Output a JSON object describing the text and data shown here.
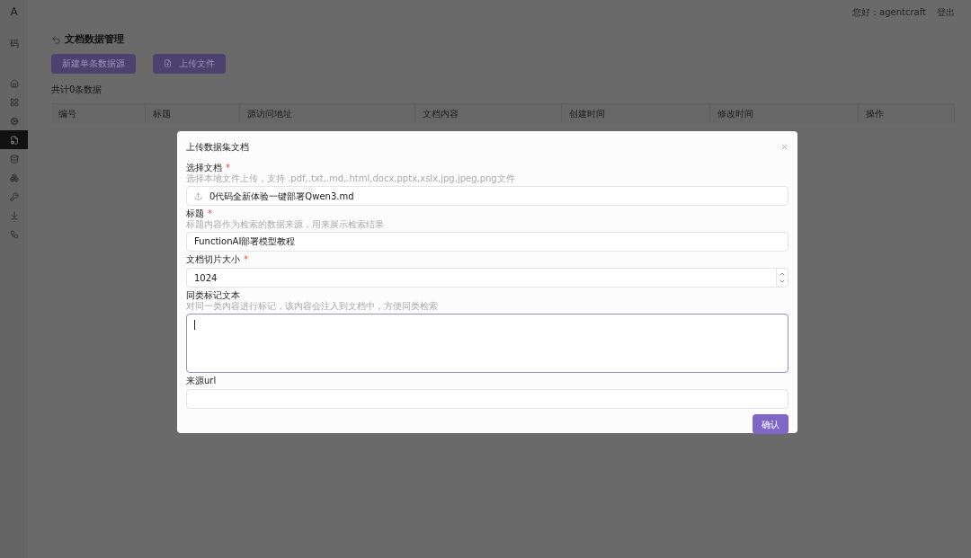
{
  "sidebar": {
    "logo": "A",
    "brand": "码",
    "items": [
      {
        "selected": false
      },
      {
        "selected": false
      },
      {
        "selected": false
      },
      {
        "selected": true
      },
      {
        "selected": false
      },
      {
        "selected": false
      },
      {
        "selected": false
      },
      {
        "selected": false
      },
      {
        "selected": false
      }
    ]
  },
  "header": {
    "greeting": "您好：agentcraft",
    "logout": "登出"
  },
  "page": {
    "title": "文档数据管理",
    "buttons": [
      {
        "label": "新建单条数据源",
        "kind": "plain"
      },
      {
        "label": "上传文件",
        "kind": "upload"
      }
    ],
    "count": "共计0条数据",
    "table": {
      "columns": [
        "编号",
        "标题",
        "源访问地址",
        "文档内容",
        "创建时间",
        "修改时间",
        "操作"
      ]
    }
  },
  "modal": {
    "title": "上传数据集文档",
    "required_mark": "*",
    "fields": [
      {
        "kind": "file",
        "label": "选择文档",
        "required": true,
        "hint": "选择本地文件上传，支持 .pdf,.txt,.md,.html,docx,pptx,xslx,jpg,jpeg,png文件",
        "value": "0代码全新体验一键部署Qwen3.md"
      },
      {
        "kind": "text",
        "label": "标题",
        "required": true,
        "hint": "标题内容作为检索的数据来源，用来展示检索结果",
        "value": "FunctionAI部署模型教程"
      },
      {
        "kind": "number",
        "label": "文档切片大小",
        "required": true,
        "value": "1024"
      },
      {
        "kind": "textarea",
        "label": "同类标记文本",
        "required": false,
        "hint": "对同一类内容进行标记，该内容会注入到文档中，方便同类检索",
        "focused": true
      },
      {
        "kind": "text",
        "label": "来源url",
        "required": false
      }
    ],
    "confirm": "确认"
  }
}
